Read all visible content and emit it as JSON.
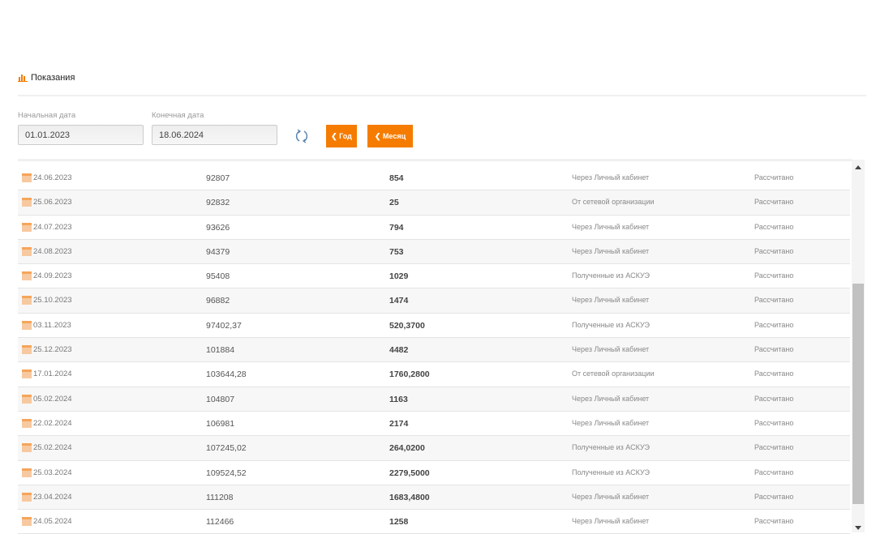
{
  "header": {
    "title": "Показания",
    "icon": "bar-chart-icon"
  },
  "filters": {
    "start_label": "Начальная дата",
    "start_value": "01.01.2023",
    "end_label": "Конечная дата",
    "end_value": "18.06.2024",
    "year_button": "❮ Год",
    "month_button": "❮ Месяц"
  },
  "colors": {
    "accent": "#f57c00"
  },
  "rows": [
    {
      "date": "24.06.2023",
      "reading": "92807",
      "delta": "854",
      "source": "Через Личный кабинет",
      "status": "Рассчитано"
    },
    {
      "date": "25.06.2023",
      "reading": "92832",
      "delta": "25",
      "source": "От сетевой организации",
      "status": "Рассчитано"
    },
    {
      "date": "24.07.2023",
      "reading": "93626",
      "delta": "794",
      "source": "Через Личный кабинет",
      "status": "Рассчитано"
    },
    {
      "date": "24.08.2023",
      "reading": "94379",
      "delta": "753",
      "source": "Через Личный кабинет",
      "status": "Рассчитано"
    },
    {
      "date": "24.09.2023",
      "reading": "95408",
      "delta": "1029",
      "source": "Полученные из АСКУЭ",
      "status": "Рассчитано"
    },
    {
      "date": "25.10.2023",
      "reading": "96882",
      "delta": "1474",
      "source": "Через Личный кабинет",
      "status": "Рассчитано"
    },
    {
      "date": "03.11.2023",
      "reading": "97402,37",
      "delta": "520,3700",
      "source": "Полученные из АСКУЭ",
      "status": "Рассчитано"
    },
    {
      "date": "25.12.2023",
      "reading": "101884",
      "delta": "4482",
      "source": "Через Личный кабинет",
      "status": "Рассчитано"
    },
    {
      "date": "17.01.2024",
      "reading": "103644,28",
      "delta": "1760,2800",
      "source": "От сетевой организации",
      "status": "Рассчитано"
    },
    {
      "date": "05.02.2024",
      "reading": "104807",
      "delta": "1163",
      "source": "Через Личный кабинет",
      "status": "Рассчитано"
    },
    {
      "date": "22.02.2024",
      "reading": "106981",
      "delta": "2174",
      "source": "Через Личный кабинет",
      "status": "Рассчитано"
    },
    {
      "date": "25.02.2024",
      "reading": "107245,02",
      "delta": "264,0200",
      "source": "Полученные из АСКУЭ",
      "status": "Рассчитано"
    },
    {
      "date": "25.03.2024",
      "reading": "109524,52",
      "delta": "2279,5000",
      "source": "Полученные из АСКУЭ",
      "status": "Рассчитано"
    },
    {
      "date": "23.04.2024",
      "reading": "111208",
      "delta": "1683,4800",
      "source": "Через Личный кабинет",
      "status": "Рассчитано"
    },
    {
      "date": "24.05.2024",
      "reading": "112466",
      "delta": "1258",
      "source": "Через Личный кабинет",
      "status": "Рассчитано"
    }
  ]
}
